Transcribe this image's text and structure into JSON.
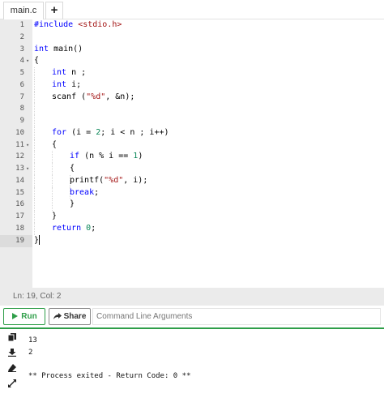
{
  "tabs": {
    "file_label": "main.c",
    "add_label": "+"
  },
  "editor": {
    "lines": [
      {
        "n": "1",
        "fold": ""
      },
      {
        "n": "2",
        "fold": ""
      },
      {
        "n": "3",
        "fold": ""
      },
      {
        "n": "4",
        "fold": "▾"
      },
      {
        "n": "5",
        "fold": ""
      },
      {
        "n": "6",
        "fold": ""
      },
      {
        "n": "7",
        "fold": ""
      },
      {
        "n": "8",
        "fold": ""
      },
      {
        "n": "9",
        "fold": ""
      },
      {
        "n": "10",
        "fold": ""
      },
      {
        "n": "11",
        "fold": "▾"
      },
      {
        "n": "12",
        "fold": ""
      },
      {
        "n": "13",
        "fold": "▾"
      },
      {
        "n": "14",
        "fold": ""
      },
      {
        "n": "15",
        "fold": ""
      },
      {
        "n": "16",
        "fold": ""
      },
      {
        "n": "17",
        "fold": ""
      },
      {
        "n": "18",
        "fold": ""
      },
      {
        "n": "19",
        "fold": ""
      }
    ],
    "code": {
      "l1_kw": "#include",
      "l1_str": "<stdio.h>",
      "l3_kw": "int",
      "l3_rest": " main()",
      "l4": "{",
      "l5_kw": "int",
      "l5_rest": " n ;",
      "l6_kw": "int",
      "l6_rest": " i;",
      "l7_a": "scanf (",
      "l7_str": "\"%d\"",
      "l7_b": ", &n);",
      "l10_kw": "for",
      "l10_a": " (i = ",
      "l10_num": "2",
      "l10_b": "; i < n ; i++)",
      "l11": "{",
      "l12_kw": "if",
      "l12_a": " (n % i == ",
      "l12_num": "1",
      "l12_b": ")",
      "l13": "{",
      "l14_a": "printf(",
      "l14_str": "\"%d\"",
      "l14_b": ", i);",
      "l15_kw": "break",
      "l15_b": ";",
      "l16": "}",
      "l17": "}",
      "l18_kw": "return",
      "l18_sp": " ",
      "l18_num": "0",
      "l18_b": ";",
      "l19": "}"
    }
  },
  "status": {
    "text": "Ln: 19,  Col: 2"
  },
  "toolbar": {
    "run_label": "Run",
    "share_label": "Share",
    "args_placeholder": "Command Line Arguments"
  },
  "console": {
    "lines": [
      "13",
      "2",
      "",
      "** Process exited - Return Code: 0 **"
    ]
  },
  "colors": {
    "accent": "#2e9e48",
    "keyword": "#0000ff",
    "string": "#a31515",
    "number": "#098658"
  }
}
